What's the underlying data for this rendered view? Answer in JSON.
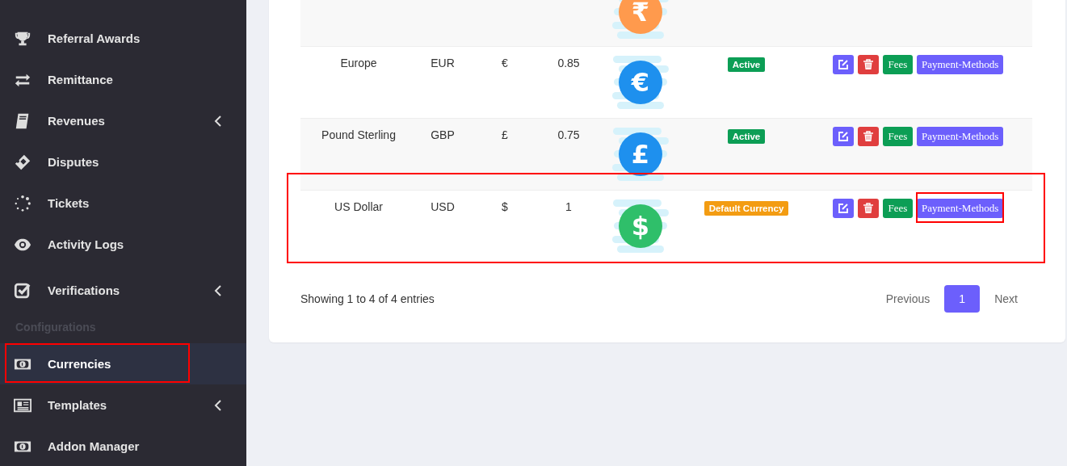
{
  "sidebar": {
    "items": [
      {
        "kind": "link",
        "label": "Referral Awards",
        "expandable": false,
        "selected": false,
        "highlighted": false
      },
      {
        "kind": "link",
        "label": "Remittance",
        "expandable": false,
        "selected": false,
        "highlighted": false
      },
      {
        "kind": "link",
        "label": "Revenues",
        "expandable": true,
        "selected": false,
        "highlighted": false
      },
      {
        "kind": "link",
        "label": "Disputes",
        "expandable": false,
        "selected": false,
        "highlighted": false
      },
      {
        "kind": "link",
        "label": "Tickets",
        "expandable": false,
        "selected": false,
        "highlighted": false
      },
      {
        "kind": "link",
        "label": "Activity Logs",
        "expandable": false,
        "selected": false,
        "highlighted": false
      },
      {
        "kind": "link",
        "label": "Verifications",
        "expandable": true,
        "selected": false,
        "highlighted": false
      },
      {
        "kind": "header",
        "label": "Configurations"
      },
      {
        "kind": "link",
        "label": "Currencies",
        "expandable": false,
        "selected": true,
        "highlighted": true
      },
      {
        "kind": "link",
        "label": "Templates",
        "expandable": true,
        "selected": false,
        "highlighted": false
      },
      {
        "kind": "link",
        "label": "Addon Manager",
        "expandable": false,
        "selected": false,
        "highlighted": false
      }
    ]
  },
  "table": {
    "rows": [
      {
        "coin": {
          "glyph": "₹",
          "color": "#ff9a4d"
        }
      },
      {
        "highlighted": false,
        "name": "Europe",
        "code": "EUR",
        "symbol": "€",
        "rate": "0.85",
        "coin": {
          "glyph": "€",
          "color": "#1e90ee"
        },
        "status": {
          "kind": "active",
          "label": "Active"
        },
        "actions": [
          {
            "kind": "edit"
          },
          {
            "kind": "delete"
          },
          {
            "kind": "fees",
            "label": "Fees"
          },
          {
            "kind": "methods",
            "label": "Payment-Methods",
            "highlighted": false
          }
        ]
      },
      {
        "highlighted": false,
        "name": "Pound Sterling",
        "code": "GBP",
        "symbol": "£",
        "rate": "0.75",
        "coin": {
          "glyph": "£",
          "color": "#1e90ee"
        },
        "status": {
          "kind": "active",
          "label": "Active"
        },
        "actions": [
          {
            "kind": "edit"
          },
          {
            "kind": "delete"
          },
          {
            "kind": "fees",
            "label": "Fees"
          },
          {
            "kind": "methods",
            "label": "Payment-Methods",
            "highlighted": false
          }
        ]
      },
      {
        "highlighted": true,
        "name": "US Dollar",
        "code": "USD",
        "symbol": "$",
        "rate": "1",
        "coin": {
          "glyph": "$",
          "color": "#2fbf6a"
        },
        "status": {
          "kind": "default",
          "label": "Default Currency"
        },
        "actions": [
          {
            "kind": "edit"
          },
          {
            "kind": "delete"
          },
          {
            "kind": "fees",
            "label": "Fees"
          },
          {
            "kind": "methods",
            "label": "Payment-Methods",
            "highlighted": true
          }
        ]
      }
    ]
  },
  "footer": {
    "info": "Showing 1 to 4 of 4 entries",
    "pagination": [
      {
        "label": "Previous",
        "selected": false
      },
      {
        "label": "1",
        "selected": true
      },
      {
        "label": "Next",
        "selected": false
      }
    ]
  }
}
